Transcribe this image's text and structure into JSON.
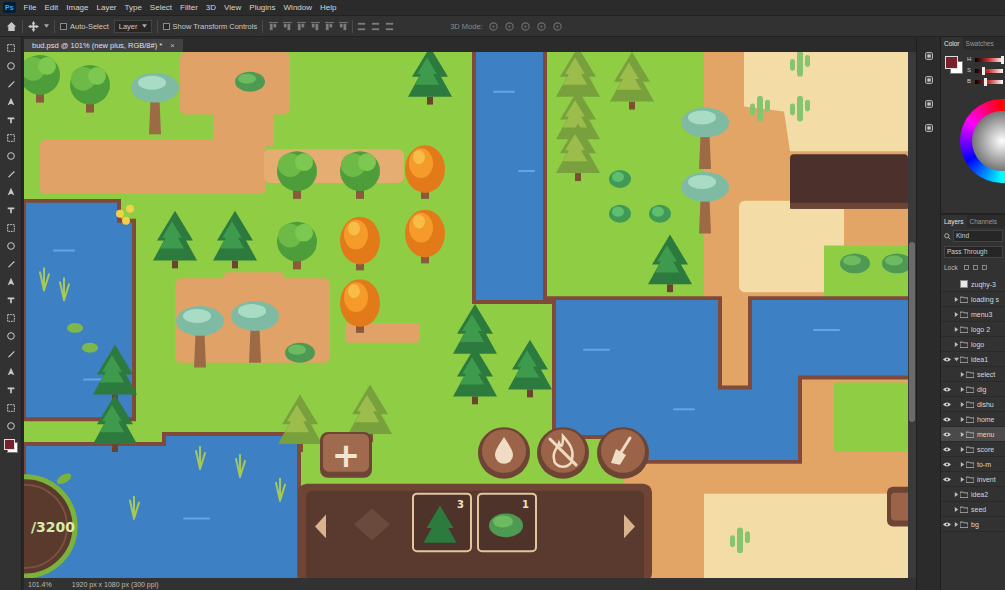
{
  "app": {
    "logo": "Ps",
    "menu": [
      "File",
      "Edit",
      "Image",
      "Layer",
      "Type",
      "Select",
      "Filter",
      "3D",
      "View",
      "Plugins",
      "Window",
      "Help"
    ]
  },
  "options_bar": {
    "auto_select": {
      "label": "Auto-Select",
      "checked": false
    },
    "target": "Layer",
    "transform_controls": {
      "label": "Show Transform Controls",
      "checked": false
    },
    "mode_label": "3D Mode:"
  },
  "document": {
    "tab_title": "bud.psd @ 101% (new plus, RGB/8#) *",
    "close": "×"
  },
  "game": {
    "score": "/3200",
    "add_button": "+",
    "inventory": {
      "items": [
        {
          "kind": "tree",
          "count": "3",
          "selected": false
        },
        {
          "kind": "bush",
          "count": "1",
          "selected": false
        }
      ]
    }
  },
  "status_bar": {
    "zoom": "101.4%",
    "size": "1920 px x 1080 px (300 ppi)"
  },
  "panels": {
    "color": {
      "tabs": [
        {
          "label": "Color",
          "selected": true
        },
        {
          "label": "Swatches",
          "selected": false
        }
      ],
      "sliders": [
        {
          "label": "H",
          "level": 0.95
        },
        {
          "label": "S",
          "level": 0.3
        },
        {
          "label": "B",
          "level": 0.35
        }
      ]
    },
    "layers": {
      "tabs": [
        {
          "label": "Layers",
          "selected": true
        },
        {
          "label": "Channels",
          "selected": false
        }
      ],
      "filter": "Kind",
      "blend_mode": "Pass Through",
      "lock_label": "Lock",
      "items": [
        {
          "name": "zuqhy-3",
          "kind": "layer",
          "visible": false,
          "selected": false
        },
        {
          "name": "loading s",
          "kind": "group",
          "visible": false,
          "expanded": false,
          "selected": false
        },
        {
          "name": "menu3",
          "kind": "group",
          "visible": false,
          "expanded": false,
          "selected": false
        },
        {
          "name": "logo 2",
          "kind": "group",
          "visible": false,
          "expanded": false,
          "selected": false
        },
        {
          "name": "logo",
          "kind": "group",
          "visible": false,
          "expanded": false,
          "selected": false
        },
        {
          "name": "idea1",
          "kind": "group",
          "visible": true,
          "expanded": true,
          "selected": false,
          "children": [
            {
              "name": "select",
              "kind": "group",
              "visible": false,
              "expanded": false,
              "selected": false
            },
            {
              "name": "dig",
              "kind": "group",
              "visible": true,
              "expanded": false,
              "selected": false
            },
            {
              "name": "dishu",
              "kind": "group",
              "visible": true,
              "expanded": false,
              "selected": false
            },
            {
              "name": "home",
              "kind": "group",
              "visible": true,
              "expanded": false,
              "selected": false
            },
            {
              "name": "menu",
              "kind": "group",
              "visible": true,
              "expanded": false,
              "selected": true
            },
            {
              "name": "score",
              "kind": "group",
              "visible": true,
              "expanded": false,
              "selected": false
            },
            {
              "name": "to-m",
              "kind": "group",
              "visible": true,
              "expanded": false,
              "selected": false
            },
            {
              "name": "invent",
              "kind": "group",
              "visible": true,
              "expanded": false,
              "selected": false
            }
          ]
        },
        {
          "name": "idea2",
          "kind": "group",
          "visible": false,
          "expanded": false,
          "selected": false
        },
        {
          "name": "seed",
          "kind": "group",
          "visible": false,
          "expanded": false,
          "selected": false
        },
        {
          "name": "bg",
          "kind": "group",
          "visible": true,
          "expanded": false,
          "selected": false
        }
      ]
    }
  }
}
